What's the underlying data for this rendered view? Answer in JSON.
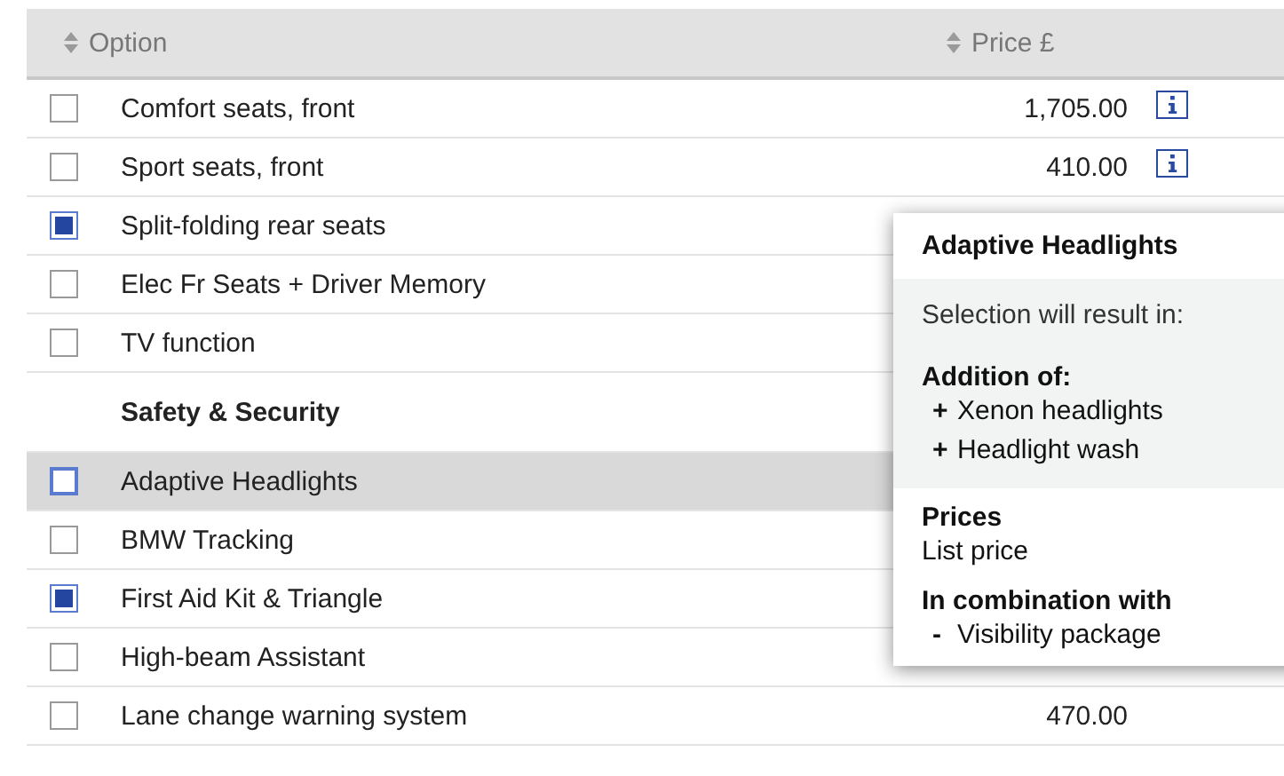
{
  "table": {
    "columns": [
      {
        "label": "Option"
      },
      {
        "label": "Price £"
      }
    ],
    "rows": [
      {
        "kind": "option",
        "label": "Comfort seats, front",
        "price": "1,705.00",
        "info": true,
        "checked": false,
        "selected": false
      },
      {
        "kind": "option",
        "label": "Sport seats, front",
        "price": "410.00",
        "info": true,
        "checked": false,
        "selected": false
      },
      {
        "kind": "option",
        "label": "Split-folding rear seats",
        "checked": true,
        "selected": false
      },
      {
        "kind": "option",
        "label": "Elec Fr Seats + Driver Memory",
        "checked": false,
        "selected": false
      },
      {
        "kind": "option",
        "label": "TV function",
        "checked": false,
        "selected": false
      },
      {
        "kind": "heading",
        "label": "Safety & Security"
      },
      {
        "kind": "option",
        "label": "Adaptive Headlights",
        "checked": false,
        "selected": true
      },
      {
        "kind": "option",
        "label": "BMW Tracking",
        "checked": false,
        "selected": false
      },
      {
        "kind": "option",
        "label": "First Aid Kit & Triangle",
        "checked": true,
        "selected": false
      },
      {
        "kind": "option",
        "label": "High-beam Assistant",
        "checked": false,
        "selected": false
      },
      {
        "kind": "option",
        "label": "Lane change warning system",
        "price": "470.00",
        "checked": false,
        "selected": false
      }
    ]
  },
  "tooltip": {
    "title": "Adaptive Headlights",
    "intro": "Selection will result in:",
    "sections": [
      {
        "heading": "Addition of:",
        "items": [
          {
            "marker": "+",
            "text": "Xenon headlights"
          },
          {
            "marker": "+",
            "text": "Headlight wash"
          }
        ],
        "shaded": true
      },
      {
        "heading": "Prices",
        "items": [
          {
            "text": "List price"
          }
        ],
        "shaded": false
      },
      {
        "heading": "In combination with",
        "items": [
          {
            "marker": "-",
            "text": "Visibility package"
          }
        ],
        "shaded": false
      }
    ]
  }
}
